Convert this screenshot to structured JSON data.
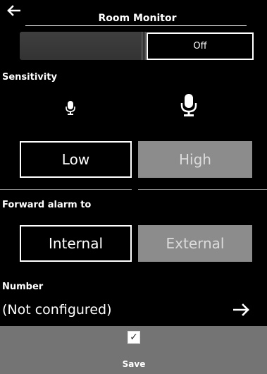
{
  "header": {
    "title": "Room Monitor",
    "back_icon": "arrow-left-icon"
  },
  "toggle": {
    "state_label": "Off"
  },
  "sensitivity": {
    "label": "Sensitivity",
    "low_icon": "microphone-small-icon",
    "high_icon": "microphone-large-icon",
    "options": [
      "Low",
      "High"
    ],
    "selected": "High"
  },
  "forward": {
    "label": "Forward alarm to",
    "options": [
      "Internal",
      "External"
    ],
    "selected": "External"
  },
  "number": {
    "label": "Number",
    "value": "(Not configured)",
    "arrow_icon": "arrow-right-icon"
  },
  "footer": {
    "checkbox_icon": "checkmark-icon",
    "checkbox_glyph": "✓",
    "save_label": "Save"
  }
}
